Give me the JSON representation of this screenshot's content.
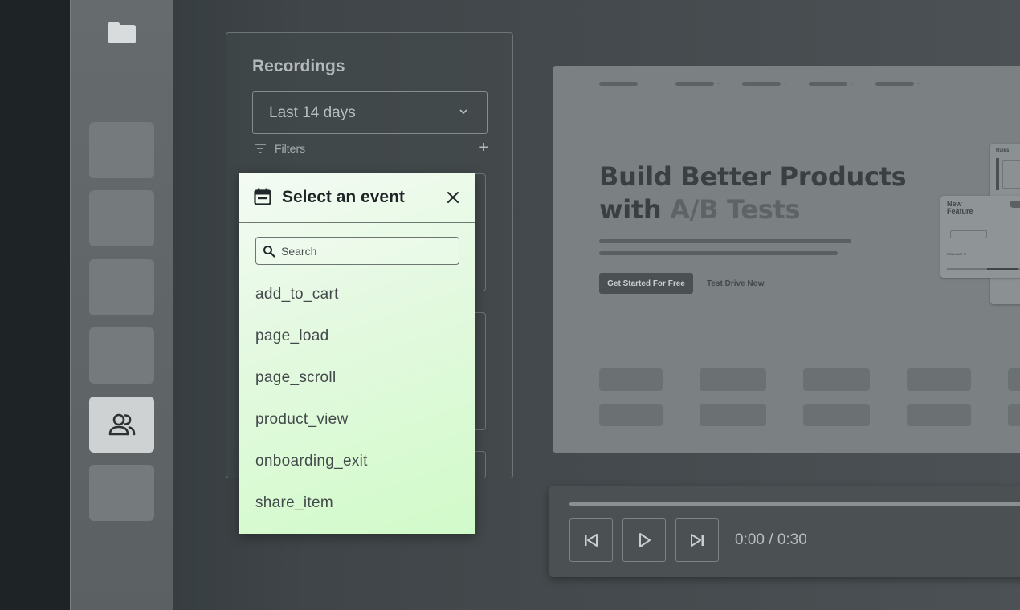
{
  "recordings_panel": {
    "title": "Recordings",
    "date_range": "Last 14 days",
    "filters_label": "Filters"
  },
  "event_dropdown": {
    "title": "Select an event",
    "search_placeholder": "Search",
    "events": [
      "add_to_cart",
      "page_load",
      "page_scroll",
      "product_view",
      "onboarding_exit",
      "share_item"
    ]
  },
  "preview": {
    "hero_line1": "Build Better Products",
    "hero_line2_prefix": "with ",
    "hero_line2_highlight": "A/B Tests",
    "cta_primary": "Get Started For Free",
    "cta_secondary": "Test Drive Now",
    "card_rules_title": "Rules",
    "card_feature_title_1": "New",
    "card_feature_title_2": "Feature",
    "card_rollout_label": "ROLLOUT %"
  },
  "player": {
    "time_display": "0:00 / 0:30"
  },
  "sidebar": {
    "active_icon": "users-icon"
  }
}
